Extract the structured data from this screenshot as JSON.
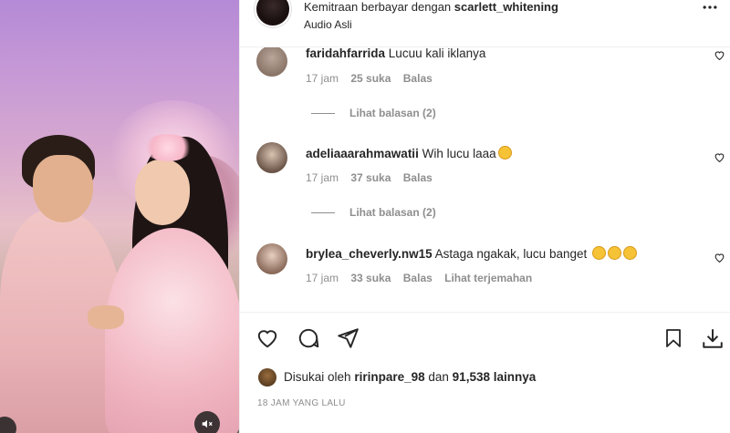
{
  "header": {
    "partnership_prefix": "Kemitraan berbayar dengan",
    "partner": "scarlett_whitening",
    "audio": "Audio Asli",
    "more_icon": "more-horizontal-icon"
  },
  "comments": [
    {
      "username": "faridahfarrida",
      "text": "Lucuu kali iklanya",
      "time": "17 jam",
      "likes": "25 suka",
      "reply": "Balas",
      "view_replies": "Lihat balasan (2)"
    },
    {
      "username": "adeliaaarahmawatii",
      "text": "Wih lucu laaa",
      "emoji": "star-struck-emoji",
      "time": "17 jam",
      "likes": "37 suka",
      "reply": "Balas",
      "view_replies": "Lihat balasan (2)"
    },
    {
      "username": "brylea_cheverly.nw15",
      "text": "Astaga ngakak, lucu banget",
      "emoji": "rolling-laughing-emoji x3",
      "time": "17 jam",
      "likes": "33 suka",
      "reply": "Balas",
      "translate": "Lihat terjemahan"
    }
  ],
  "actions": {
    "like_icon": "heart-icon",
    "comment_icon": "comment-icon",
    "share_icon": "send-icon",
    "save_icon": "bookmark-icon",
    "download_icon": "download-icon"
  },
  "likes": {
    "prefix": "Disukai oleh",
    "user": "ririnpare_98",
    "middle": "dan",
    "count": "91,538 lainnya"
  },
  "timestamp": "18 JAM YANG LALU",
  "media": {
    "mute_icon": "speaker-muted-icon"
  }
}
